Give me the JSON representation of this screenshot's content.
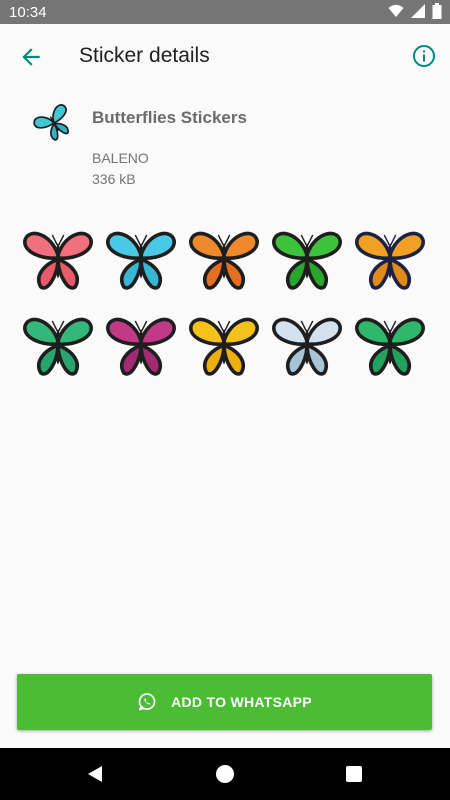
{
  "status_bar": {
    "time": "10:34"
  },
  "app_bar": {
    "title": "Sticker details"
  },
  "pack": {
    "name": "Butterflies Stickers",
    "publisher": "BALENO",
    "size": "336 kB",
    "icon_colors": {
      "upper": "#3fc7d8",
      "lower": "#2bb3c8",
      "edge": "#1c1c1c"
    }
  },
  "stickers": [
    {
      "name": "pink butterfly",
      "upper": "#f2707e",
      "lower": "#e85a6c",
      "edge": "#1e1e1e"
    },
    {
      "name": "blue swallowtail",
      "upper": "#49c9e3",
      "lower": "#37b6d6",
      "edge": "#1e1e1e"
    },
    {
      "name": "orange butterfly",
      "upper": "#ef8a2c",
      "lower": "#e36f1f",
      "edge": "#1e1e1e"
    },
    {
      "name": "green swallowtail",
      "upper": "#3ec23c",
      "lower": "#2aa52d",
      "edge": "#1e1e1e"
    },
    {
      "name": "orange navy butterfly",
      "upper": "#f0a024",
      "lower": "#e08a1c",
      "edge": "#1c2340"
    },
    {
      "name": "teal butterfly",
      "upper": "#33b77a",
      "lower": "#26a56e",
      "edge": "#1e1e1e"
    },
    {
      "name": "magenta butterfly",
      "upper": "#c23a87",
      "lower": "#a42a73",
      "edge": "#1e1e1e"
    },
    {
      "name": "yellow butterfly",
      "upper": "#f5c21a",
      "lower": "#eeb011",
      "edge": "#1e1e1e"
    },
    {
      "name": "pale blue butterfly",
      "upper": "#d3e2ee",
      "lower": "#a8c3d8",
      "edge": "#1e1e1e"
    },
    {
      "name": "green black butterfly",
      "upper": "#2fb86c",
      "lower": "#22a25d",
      "edge": "#1e1e1e"
    }
  ],
  "add_button": {
    "label": "ADD TO WHATSAPP"
  },
  "colors": {
    "accent": "#00897b",
    "button": "#4cbc34",
    "status_bar": "#757575",
    "nav_bar": "#000000"
  }
}
